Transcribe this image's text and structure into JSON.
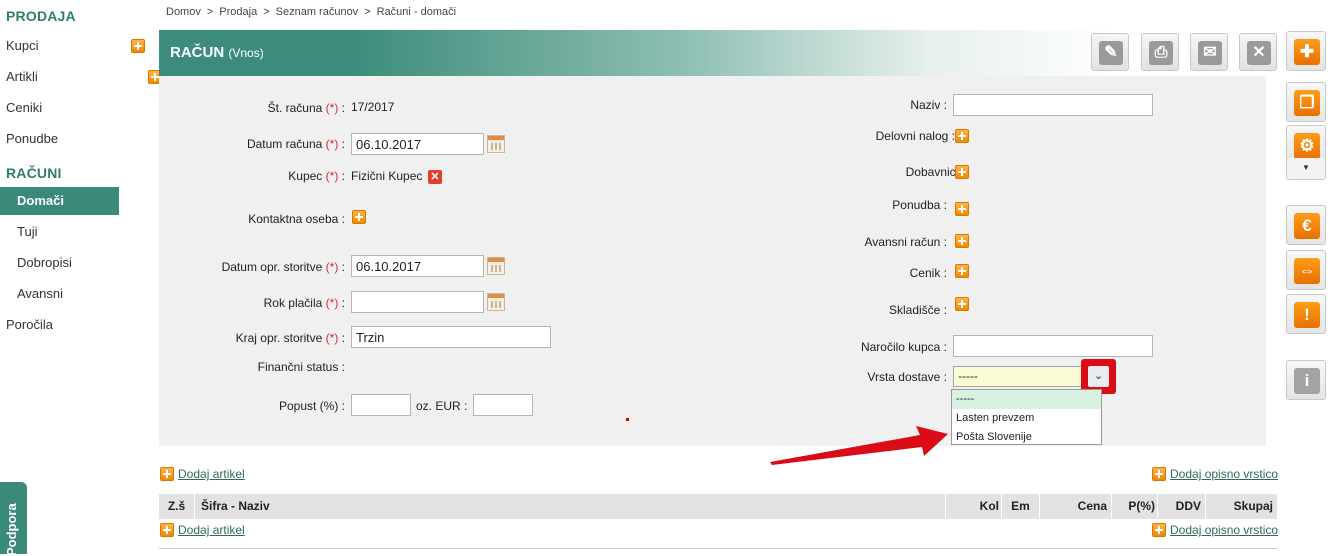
{
  "sidebar": {
    "sections": [
      {
        "heading": "PRODAJA",
        "items": [
          {
            "label": "Kupci"
          },
          {
            "label": "Artikli"
          },
          {
            "label": "Ceniki"
          },
          {
            "label": "Ponudbe"
          }
        ]
      },
      {
        "heading": "RAČUNI",
        "items": [
          {
            "label": "Domači",
            "active": true
          },
          {
            "label": "Tuji"
          },
          {
            "label": "Dobropisi"
          },
          {
            "label": "Avansni"
          }
        ]
      }
    ],
    "reports": "Poročila",
    "support_tab": "Podpora"
  },
  "breadcrumb": [
    "Domov",
    "Prodaja",
    "Seznam računov",
    "Računi - domači"
  ],
  "breadcrumb_sep": ">",
  "title": {
    "main": "RAČUN",
    "sub": "(Vnos)"
  },
  "toolbar_icons": [
    "pencil-icon",
    "print-icon",
    "mail-icon",
    "close-icon",
    "add-icon"
  ],
  "right_icons": [
    "copy-icon",
    "gear-icon",
    "euro-icon",
    "split-icon",
    "warning-icon",
    "info-icon"
  ],
  "form": {
    "required_mark": "(*)",
    "invoice_no": {
      "label": "Št. računa",
      "value": "17/2017"
    },
    "invoice_date": {
      "label": "Datum računa",
      "value": "06.10.2017"
    },
    "customer": {
      "label": "Kupec",
      "value": "Fizični Kupec"
    },
    "contact": {
      "label": "Kontaktna oseba :"
    },
    "service_date": {
      "label": "Datum opr. storitve",
      "value": "06.10.2017"
    },
    "due_date": {
      "label": "Rok plačila",
      "value": ""
    },
    "service_place": {
      "label": "Kraj opr. storitve",
      "value": "Trzin"
    },
    "financial_status": {
      "label": "Finančni status :"
    },
    "discount": {
      "label": "Popust (%) :",
      "value": "",
      "eur_label": "oz. EUR :",
      "eur_value": ""
    },
    "name": {
      "label": "Naziv :",
      "value": ""
    },
    "work_order": {
      "label": "Delovni nalog :"
    },
    "delivery_note": {
      "label": "Dobavnica :"
    },
    "offer": {
      "label": "Ponudba :"
    },
    "advance_invoice": {
      "label": "Avansni račun :"
    },
    "price_list": {
      "label": "Cenik :"
    },
    "warehouse": {
      "label": "Skladišče :"
    },
    "customer_order": {
      "label": "Naročilo kupca :",
      "value": ""
    },
    "delivery_type": {
      "label": "Vrsta dostave :",
      "value": "-----",
      "options": [
        "-----",
        "Lasten prevzem",
        "Pošta Slovenije"
      ]
    }
  },
  "links": {
    "add_item": "Dodaj artikel",
    "add_desc_row": "Dodaj opisno vrstico"
  },
  "table": {
    "headers": [
      "Z.š",
      "Šifra - Naziv",
      "Kol",
      "Em",
      "Cena",
      "P(%)",
      "DDV",
      "Skupaj"
    ]
  },
  "colors": {
    "accent": "#3a8a7a",
    "highlight": "#d90c18",
    "orange": "#f08a00"
  }
}
